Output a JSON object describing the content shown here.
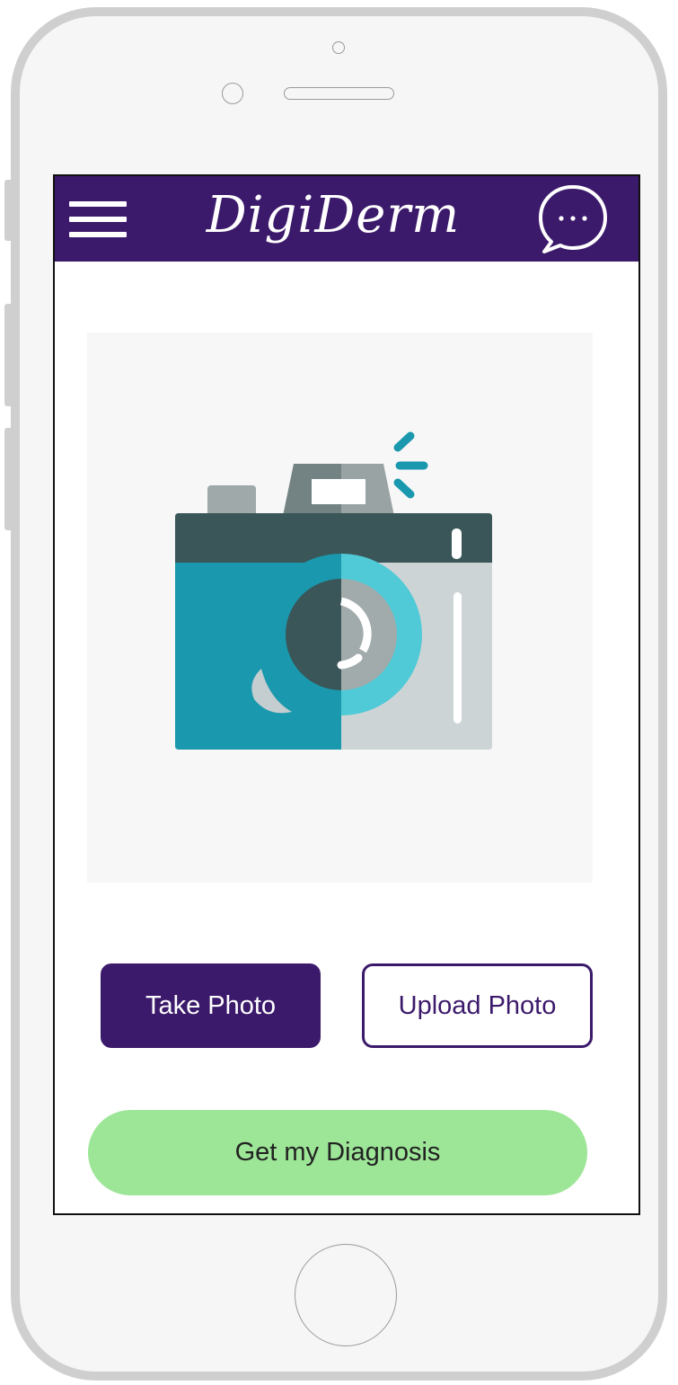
{
  "header": {
    "app_name": "DigiDerm",
    "menu_icon": "hamburger-menu-icon",
    "chat_icon": "chat-bubble-icon",
    "background": "#3c1a6b"
  },
  "photo": {
    "icon": "camera-icon"
  },
  "actions": {
    "take_photo": "Take Photo",
    "upload_photo": "Upload Photo",
    "get_diagnosis": "Get my Diagnosis"
  },
  "colors": {
    "primary": "#3c1a6b",
    "diagnosis_button": "#9de697"
  }
}
